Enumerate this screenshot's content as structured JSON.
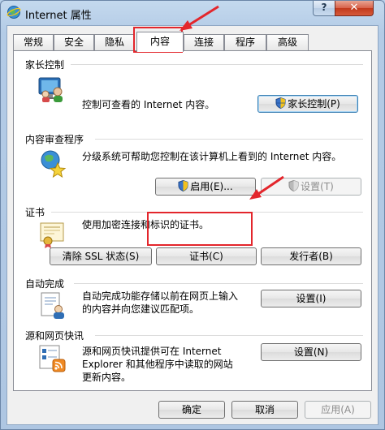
{
  "window": {
    "title": "Internet 属性",
    "help_label": "?",
    "close_label": "✕"
  },
  "tabs": [
    {
      "label": "常规"
    },
    {
      "label": "安全"
    },
    {
      "label": "隐私"
    },
    {
      "label": "内容"
    },
    {
      "label": "连接"
    },
    {
      "label": "程序"
    },
    {
      "label": "高级"
    }
  ],
  "active_tab": "内容",
  "parental": {
    "header": "家长控制",
    "desc": "控制可查看的 Internet 内容。",
    "button": "家长控制(P)"
  },
  "advisor": {
    "header": "内容审查程序",
    "desc_line1": "分级系统可帮助您控制在该计算机上看到的 Internet 内容。",
    "enable_button": "启用(E)...",
    "settings_button": "设置(T)"
  },
  "certs": {
    "header": "证书",
    "desc": "使用加密连接和标识的证书。",
    "clear_ssl_button": "清除 SSL 状态(S)",
    "certs_button": "证书(C)",
    "publishers_button": "发行者(B)"
  },
  "autocomplete": {
    "header": "自动完成",
    "desc_line1": "自动完成功能存储以前在网页上输入",
    "desc_line2": "的内容并向您建议匹配项。",
    "settings_button": "设置(I)"
  },
  "feeds": {
    "header": "源和网页快讯",
    "desc_line1": "源和网页快讯提供可在 Internet",
    "desc_line2": "Explorer 和其他程序中读取的网站",
    "desc_line3": "更新内容。",
    "settings_button": "设置(N)"
  },
  "footer": {
    "ok_button": "确定",
    "cancel_button": "取消",
    "apply_button": "应用(A)"
  },
  "colors": {
    "annotation_red": "#e3262c"
  }
}
